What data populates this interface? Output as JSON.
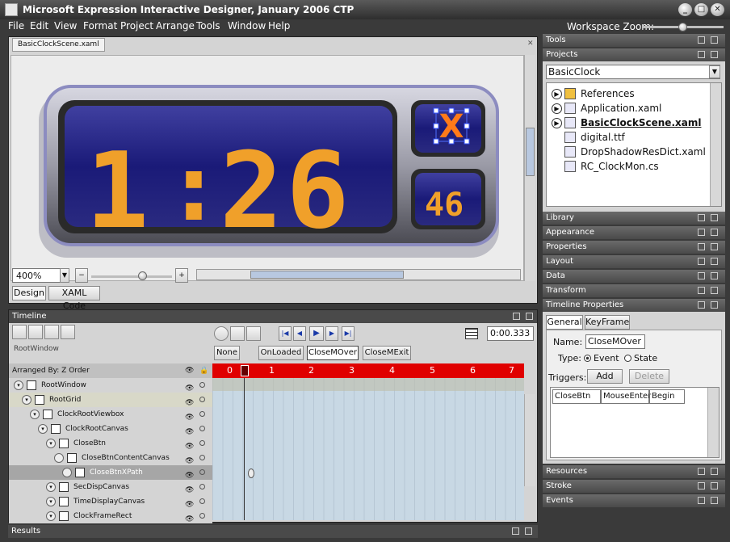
{
  "window": {
    "title": "Microsoft Expression Interactive Designer, January 2006 CTP"
  },
  "menu": [
    "File",
    "Edit",
    "View",
    "Format",
    "Project",
    "Arrange",
    "Tools",
    "Window",
    "Help"
  ],
  "workspace_zoom": {
    "label": "Workspace Zoom:"
  },
  "document": {
    "tab": "BasicClockScene.xaml",
    "clock": {
      "hours": "1",
      "minutes": "26",
      "seconds": "46",
      "close_glyph": "X"
    },
    "zoom": {
      "value": "400%"
    },
    "view_tabs": [
      "Design",
      "XAML Code"
    ]
  },
  "timeline": {
    "title": "Timeline",
    "root_label": "RootWindow",
    "storyboards": [
      "None",
      "OnLoaded",
      "CloseMOver",
      "CloseMExit"
    ],
    "time_value": "0:00.333",
    "arranged_by": "Arranged By: Z Order",
    "ruler": [
      "0",
      "1",
      "2",
      "3",
      "4",
      "5",
      "6",
      "7"
    ],
    "tree": [
      {
        "name": "RootWindow",
        "indent": 0,
        "selected": false
      },
      {
        "name": "RootGrid",
        "indent": 1,
        "selected": false
      },
      {
        "name": "ClockRootViewbox",
        "indent": 2,
        "selected": false
      },
      {
        "name": "ClockRootCanvas",
        "indent": 3,
        "selected": false
      },
      {
        "name": "CloseBtn",
        "indent": 4,
        "selected": false
      },
      {
        "name": "CloseBtnContentCanvas",
        "indent": 5,
        "selected": false
      },
      {
        "name": "CloseBtnXPath",
        "indent": 6,
        "selected": true
      },
      {
        "name": "SecDispCanvas",
        "indent": 4,
        "selected": false
      },
      {
        "name": "TimeDisplayCanvas",
        "indent": 4,
        "selected": false
      },
      {
        "name": "ClockFrameRect",
        "indent": 4,
        "selected": false
      }
    ]
  },
  "results": {
    "title": "Results"
  },
  "right_panel": {
    "tools": "Tools",
    "projects": "Projects",
    "project_name": "BasicClock",
    "files": [
      {
        "name": "References",
        "arrow": true,
        "bold": false
      },
      {
        "name": "Application.xaml",
        "arrow": true,
        "bold": false
      },
      {
        "name": "BasicClockScene.xaml",
        "arrow": true,
        "bold": true
      },
      {
        "name": "digital.ttf",
        "arrow": false,
        "bold": false
      },
      {
        "name": "DropShadowResDict.xaml",
        "arrow": false,
        "bold": false
      },
      {
        "name": "RC_ClockMon.cs",
        "arrow": false,
        "bold": false
      }
    ],
    "collapsed_top": [
      "Library",
      "Appearance",
      "Properties",
      "Layout",
      "Data",
      "Transform"
    ],
    "timeline_properties": {
      "title": "Timeline Properties",
      "tabs": [
        "General",
        "KeyFrame"
      ],
      "name_label": "Name:",
      "name_value": "CloseMOver",
      "type_label": "Type:",
      "type_event": "Event",
      "type_state": "State",
      "triggers_label": "Triggers:",
      "add": "Add",
      "delete": "Delete",
      "trigger_row": [
        "CloseBtn",
        "MouseEnter",
        "Begin"
      ]
    },
    "collapsed_bottom": [
      "Resources",
      "Stroke",
      "Events"
    ]
  }
}
